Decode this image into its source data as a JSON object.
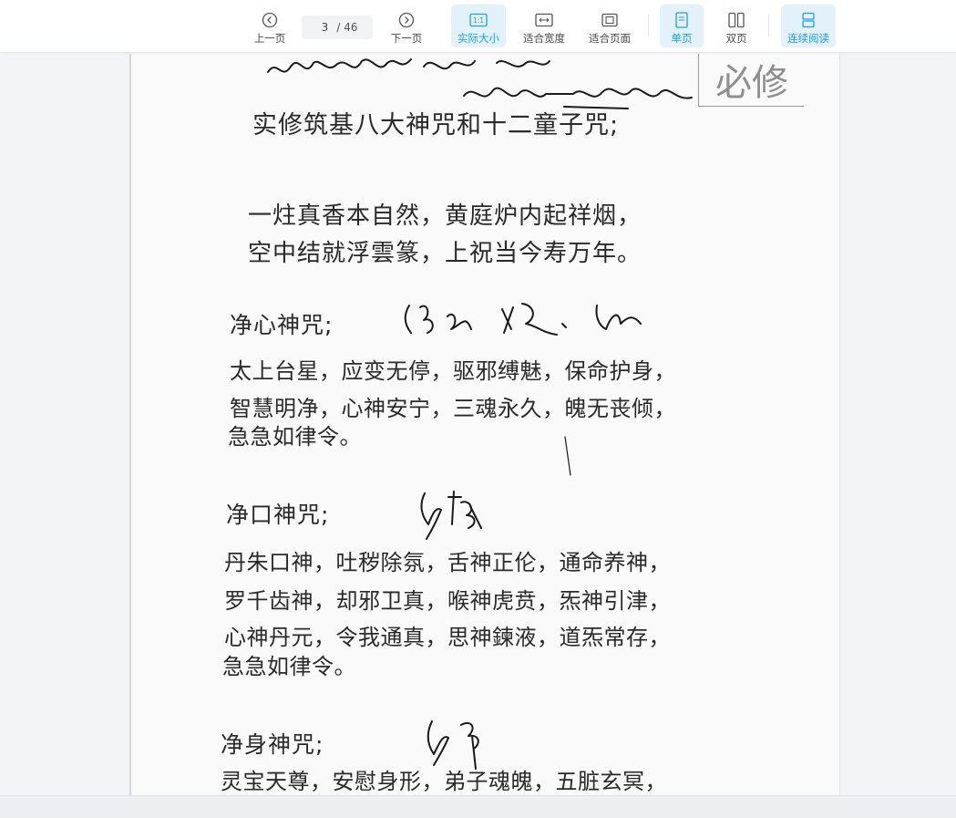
{
  "toolbar": {
    "prev_label": "上一页",
    "next_label": "下一页",
    "page_current": "3",
    "page_total": "/ 46",
    "actual_size_label": "实际大小",
    "actual_size_icon_text": "1:1",
    "fit_width_label": "适合宽度",
    "fit_page_label": "适合页面",
    "single_page_label": "单页",
    "double_page_label": "双页",
    "continuous_label": "连续阅读",
    "accent_color": "#1f9fe6",
    "active_bg": "#e3f1fb"
  },
  "document": {
    "title": "实修筑基八大神咒和十二童子咒;",
    "verse": [
      "一炷真香本自然，黄庭炉内起祥烟，",
      "空中结就浮雲篆，上祝当今寿万年。"
    ],
    "sections": [
      {
        "heading": "净心神咒;",
        "lines": [
          "太上台星，应变无停，驱邪缚魅，保命护身，",
          "智慧明净，心神安宁，三魂永久，魄无丧倾，",
          "急急如律令。"
        ]
      },
      {
        "heading": "净口神咒;",
        "lines": [
          "丹朱口神，吐秽除氛，舌神正伦，通命养神，",
          "罗千齿神，却邪卫真，喉神虎贲，炁神引津，",
          "心神丹元，令我通真，思神鍊液，道炁常存，",
          "急急如律令。"
        ]
      },
      {
        "heading": "净身神咒;",
        "lines": [
          "灵宝天尊，安慰身形，弟子魂魄，五脏玄冥，"
        ]
      }
    ],
    "stamp_text": "必修"
  }
}
